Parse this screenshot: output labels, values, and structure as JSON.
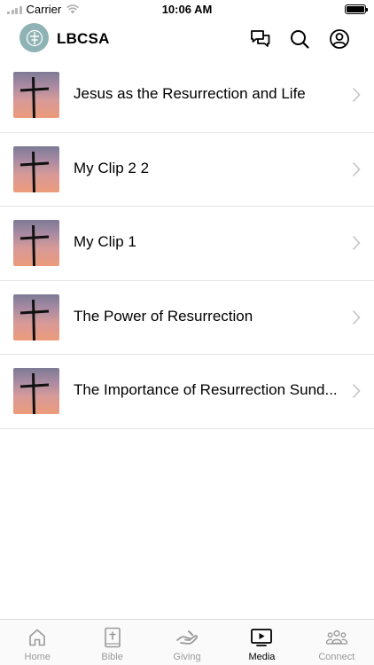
{
  "status_bar": {
    "carrier": "Carrier",
    "time": "10:06 AM"
  },
  "header": {
    "title": "LBCSA"
  },
  "icons": {
    "messages": "chat-bubbles-icon",
    "search": "search-icon",
    "profile": "account-circle-icon"
  },
  "media": {
    "items": [
      {
        "title": "Jesus as the Resurrection and Life"
      },
      {
        "title": "My Clip 2 2"
      },
      {
        "title": "My Clip 1"
      },
      {
        "title": "The Power of Resurrection"
      },
      {
        "title": "The Importance of Resurrection Sund..."
      }
    ]
  },
  "tab_bar": {
    "tabs": [
      {
        "label": "Home",
        "icon": "home-icon"
      },
      {
        "label": "Bible",
        "icon": "bible-icon"
      },
      {
        "label": "Giving",
        "icon": "giving-hand-icon"
      },
      {
        "label": "Media",
        "icon": "media-play-icon"
      },
      {
        "label": "Connect",
        "icon": "people-icon"
      }
    ],
    "active": "Media"
  },
  "colors": {
    "active_tab": "#000000",
    "inactive_tab": "#9a9a9a",
    "logo_bg": "#8fb3b4",
    "divider": "#e5e5e5"
  }
}
